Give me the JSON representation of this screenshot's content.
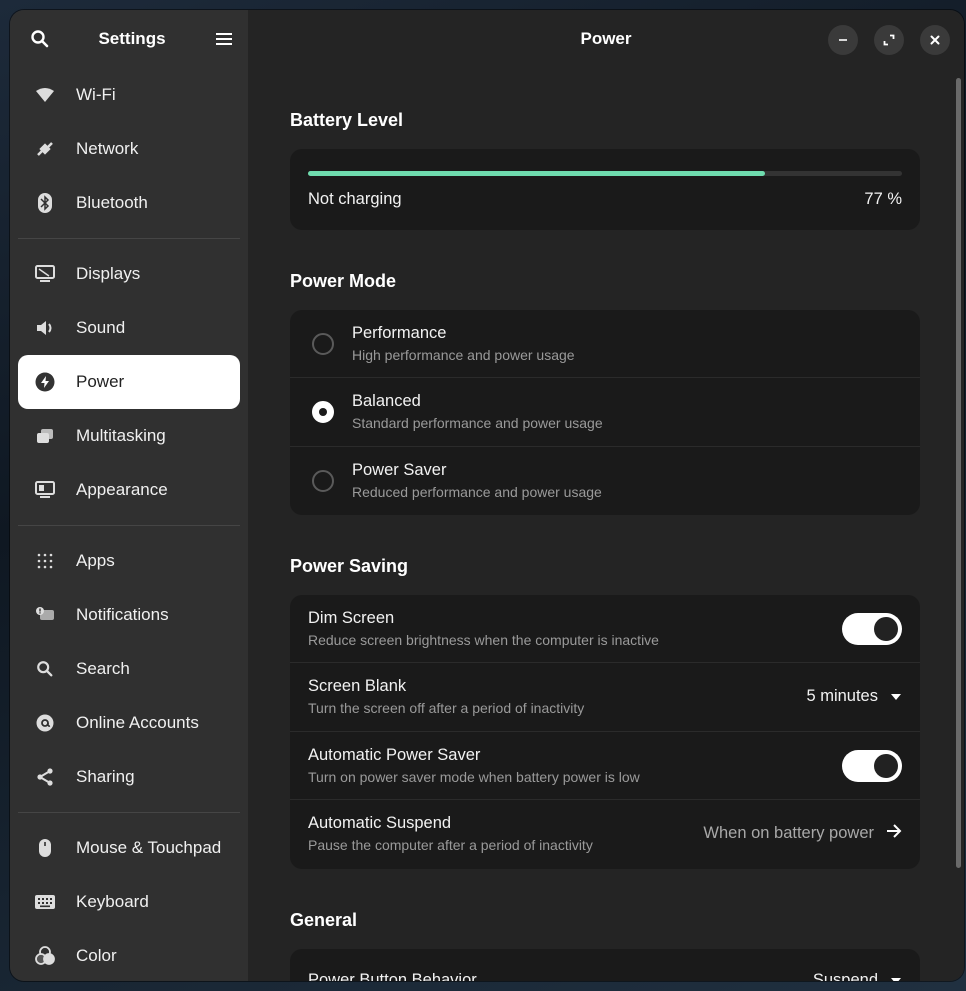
{
  "sidebar": {
    "title": "Settings",
    "search_icon": "search-icon",
    "menu_icon": "menu-icon",
    "groups": [
      [
        {
          "label": "Wi-Fi",
          "icon": "wifi-icon"
        },
        {
          "label": "Network",
          "icon": "network-icon"
        },
        {
          "label": "Bluetooth",
          "icon": "bluetooth-icon"
        }
      ],
      [
        {
          "label": "Displays",
          "icon": "display-icon"
        },
        {
          "label": "Sound",
          "icon": "sound-icon"
        },
        {
          "label": "Power",
          "icon": "power-icon",
          "active": true
        },
        {
          "label": "Multitasking",
          "icon": "multitasking-icon"
        },
        {
          "label": "Appearance",
          "icon": "appearance-icon"
        }
      ],
      [
        {
          "label": "Apps",
          "icon": "apps-grid-icon"
        },
        {
          "label": "Notifications",
          "icon": "notifications-icon"
        },
        {
          "label": "Search",
          "icon": "search-icon"
        },
        {
          "label": "Online Accounts",
          "icon": "at-sign-icon"
        },
        {
          "label": "Sharing",
          "icon": "share-icon"
        }
      ],
      [
        {
          "label": "Mouse & Touchpad",
          "icon": "mouse-icon"
        },
        {
          "label": "Keyboard",
          "icon": "keyboard-icon"
        },
        {
          "label": "Color",
          "icon": "color-icon"
        }
      ]
    ]
  },
  "header": {
    "title": "Power",
    "controls": [
      "minimize-icon",
      "maximize-icon",
      "close-icon"
    ]
  },
  "battery": {
    "section_title": "Battery Level",
    "status": "Not charging",
    "percent_label": "77 %",
    "level": 0.77,
    "bar_color": "#6fdcae"
  },
  "power_mode": {
    "section_title": "Power Mode",
    "options": [
      {
        "title": "Performance",
        "subtitle": "High performance and power usage",
        "selected": false
      },
      {
        "title": "Balanced",
        "subtitle": "Standard performance and power usage",
        "selected": true
      },
      {
        "title": "Power Saver",
        "subtitle": "Reduced performance and power usage",
        "selected": false
      }
    ]
  },
  "power_saving": {
    "section_title": "Power Saving",
    "dim_screen": {
      "title": "Dim Screen",
      "subtitle": "Reduce screen brightness when the computer is inactive",
      "enabled": true
    },
    "screen_blank": {
      "title": "Screen Blank",
      "subtitle": "Turn the screen off after a period of inactivity",
      "value": "5 minutes"
    },
    "auto_power_saver": {
      "title": "Automatic Power Saver",
      "subtitle": "Turn on power saver mode when battery power is low",
      "enabled": true
    },
    "auto_suspend": {
      "title": "Automatic Suspend",
      "subtitle": "Pause the computer after a period of inactivity",
      "value": "When on battery power"
    }
  },
  "general": {
    "section_title": "General",
    "power_button": {
      "title": "Power Button Behavior",
      "value": "Suspend"
    }
  }
}
